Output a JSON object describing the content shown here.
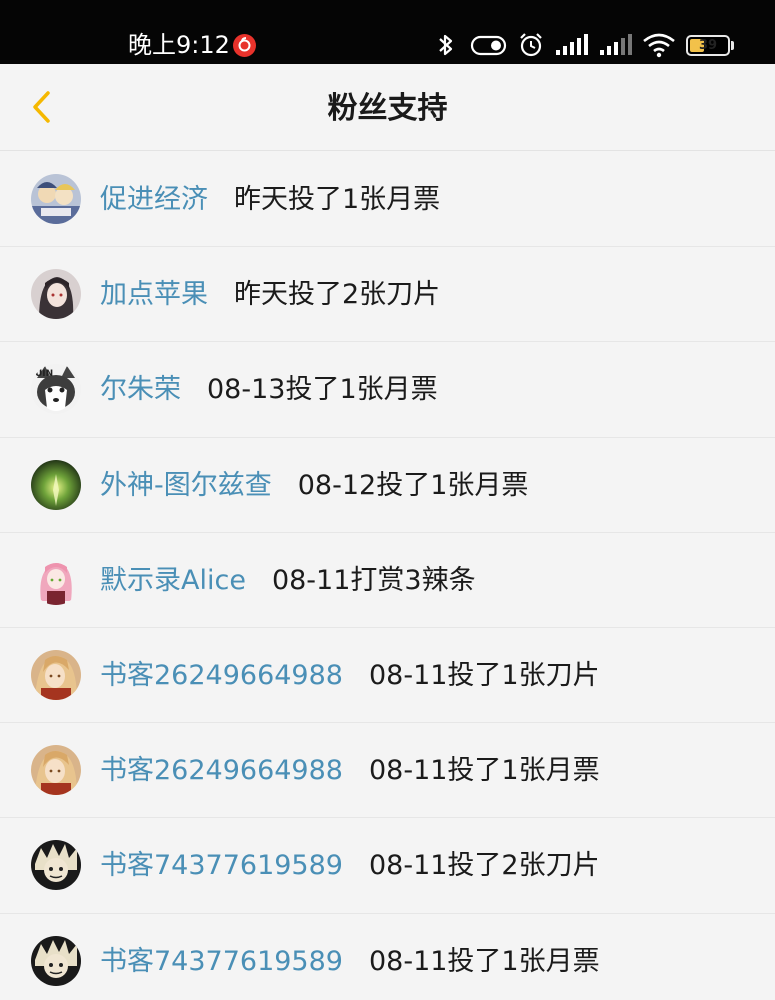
{
  "status_bar": {
    "time": "晚上9:12",
    "battery_level": "39",
    "battery_percent": 39,
    "icons": [
      "netease-music-icon",
      "bluetooth-icon",
      "toggle-icon",
      "alarm-icon",
      "signal-icon",
      "signal-weak-icon",
      "wifi-icon",
      "battery-icon"
    ]
  },
  "header": {
    "title": "粉丝支持",
    "back_icon": "chevron-left-icon",
    "accent_color": "#f5b800"
  },
  "colors": {
    "username": "#4a8fb6",
    "action": "#1b1b1b",
    "background": "#f4f4f4"
  },
  "supporters": [
    {
      "username": "促进经济",
      "action": "昨天投了1张月票",
      "avatar": "anime-group-avatar"
    },
    {
      "username": "加点苹果",
      "action": "昨天投了2张刀片",
      "avatar": "dark-hair-girl-avatar"
    },
    {
      "username": "尔朱荣",
      "action": "08-13投了1张月票",
      "avatar": "husky-dog-avatar"
    },
    {
      "username": "外神-图尔兹查",
      "action": "08-12投了1张月票",
      "avatar": "green-glow-avatar"
    },
    {
      "username": "默示录Alice",
      "action": "08-11打赏3辣条",
      "avatar": "pink-hair-girl-avatar"
    },
    {
      "username": "书客26249664988",
      "action": "08-11投了1张刀片",
      "avatar": "blonde-girl-avatar"
    },
    {
      "username": "书客26249664988",
      "action": "08-11投了1张月票",
      "avatar": "blonde-girl-avatar"
    },
    {
      "username": "书客74377619589",
      "action": "08-11投了2张刀片",
      "avatar": "spiky-hair-avatar"
    },
    {
      "username": "书客74377619589",
      "action": "08-11投了1张月票",
      "avatar": "spiky-hair-avatar"
    }
  ]
}
